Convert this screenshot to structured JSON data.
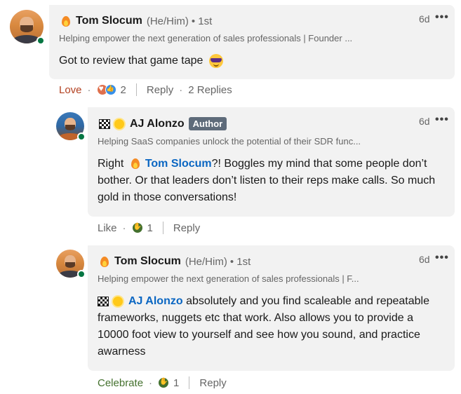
{
  "comments": [
    {
      "name": "Tom Slocum",
      "pronouns": "(He/Him)",
      "degree": "• 1st",
      "headline": "Helping empower the next generation of sales professionals | Founder ...",
      "time": "6d",
      "more": "•••",
      "body": "Got to review that game tape",
      "body_emoji": "sunglasses-emoji",
      "actions": {
        "reaction": "Love",
        "reaction_count": "2",
        "reply": "Reply",
        "replies": "2 Replies"
      }
    },
    {
      "name": "AJ Alonzo",
      "badge": "Author",
      "headline": "Helping SaaS companies unlock the potential of their SDR func...",
      "time": "6d",
      "more": "•••",
      "body_prefix": "Right",
      "mention": "Tom Slocum",
      "body_suffix": "?! Boggles my mind that some people don’t bother. Or that leaders don’t listen to their reps make calls. So much gold in those conversations!",
      "actions": {
        "reaction": "Like",
        "reaction_count": "1",
        "reply": "Reply"
      }
    },
    {
      "name": "Tom Slocum",
      "pronouns": "(He/Him)",
      "degree": "• 1st",
      "headline": "Helping empower the next generation of sales professionals | F...",
      "time": "6d",
      "more": "•••",
      "mention": "AJ Alonzo",
      "body_suffix": "absolutely and you find scaleable and repeatable frameworks, nuggets etc that work. Also allows you to provide a 10000 foot view to yourself and see how you sound, and practice awarness",
      "actions": {
        "reaction": "Celebrate",
        "reaction_count": "1",
        "reply": "Reply"
      }
    }
  ],
  "colors": {
    "bubble": "#f2f2f2",
    "mention": "#0a66c2",
    "love": "#b24020",
    "celebrate": "#44712e",
    "online": "#057642",
    "author_badge": "#5e6b7a"
  }
}
